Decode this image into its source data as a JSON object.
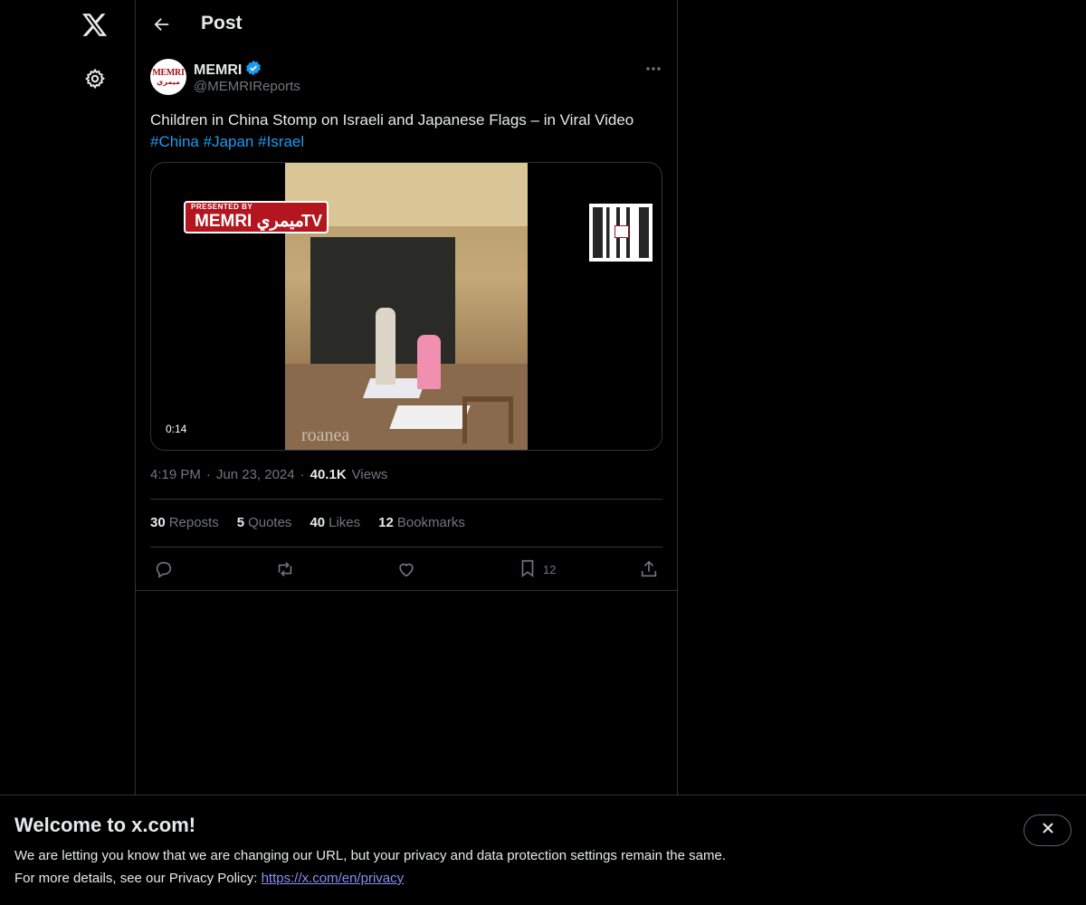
{
  "header": {
    "title": "Post"
  },
  "author": {
    "avatar_top": "MEMRI",
    "avatar_bottom": "ميمري",
    "name": "MEMRI",
    "handle": "@MEMRIReports",
    "verified": true
  },
  "tweet": {
    "text": "Children in China Stomp on Israeli and Japanese Flags – in Viral Video",
    "hashtags": [
      "#China",
      "#Japan",
      "#Israel"
    ]
  },
  "media": {
    "duration": "0:14",
    "badge_presented": "PRESENTED BY",
    "badge_logo": "MEMRI ميمري",
    "badge_suffix": "TV",
    "watermark": "roanea"
  },
  "meta": {
    "time": "4:19 PM",
    "separator": "·",
    "date": "Jun 23, 2024",
    "views_count": "40.1K",
    "views_label": "Views"
  },
  "stats": {
    "reposts_count": "30",
    "reposts_label": "Reposts",
    "quotes_count": "5",
    "quotes_label": "Quotes",
    "likes_count": "40",
    "likes_label": "Likes",
    "bookmarks_count": "12",
    "bookmarks_label": "Bookmarks"
  },
  "actions": {
    "bookmark_count": "12"
  },
  "banner": {
    "title": "Welcome to x.com!",
    "line1": "We are letting you know that we are changing our URL, but your privacy and data protection settings remain the same.",
    "line2_prefix": "For more details, see our Privacy Policy: ",
    "link": "https://x.com/en/privacy"
  },
  "colors": {
    "background": "#000000",
    "text_primary": "#e7e9ea",
    "text_secondary": "#71767b",
    "accent": "#1d9bf0",
    "border": "#2f3336"
  },
  "icons": [
    "x-logo-icon",
    "settings-gear-icon",
    "back-arrow-icon",
    "verified-badge-icon",
    "more-dots-icon",
    "reply-icon",
    "repost-icon",
    "like-icon",
    "bookmark-icon",
    "share-icon",
    "close-icon"
  ]
}
